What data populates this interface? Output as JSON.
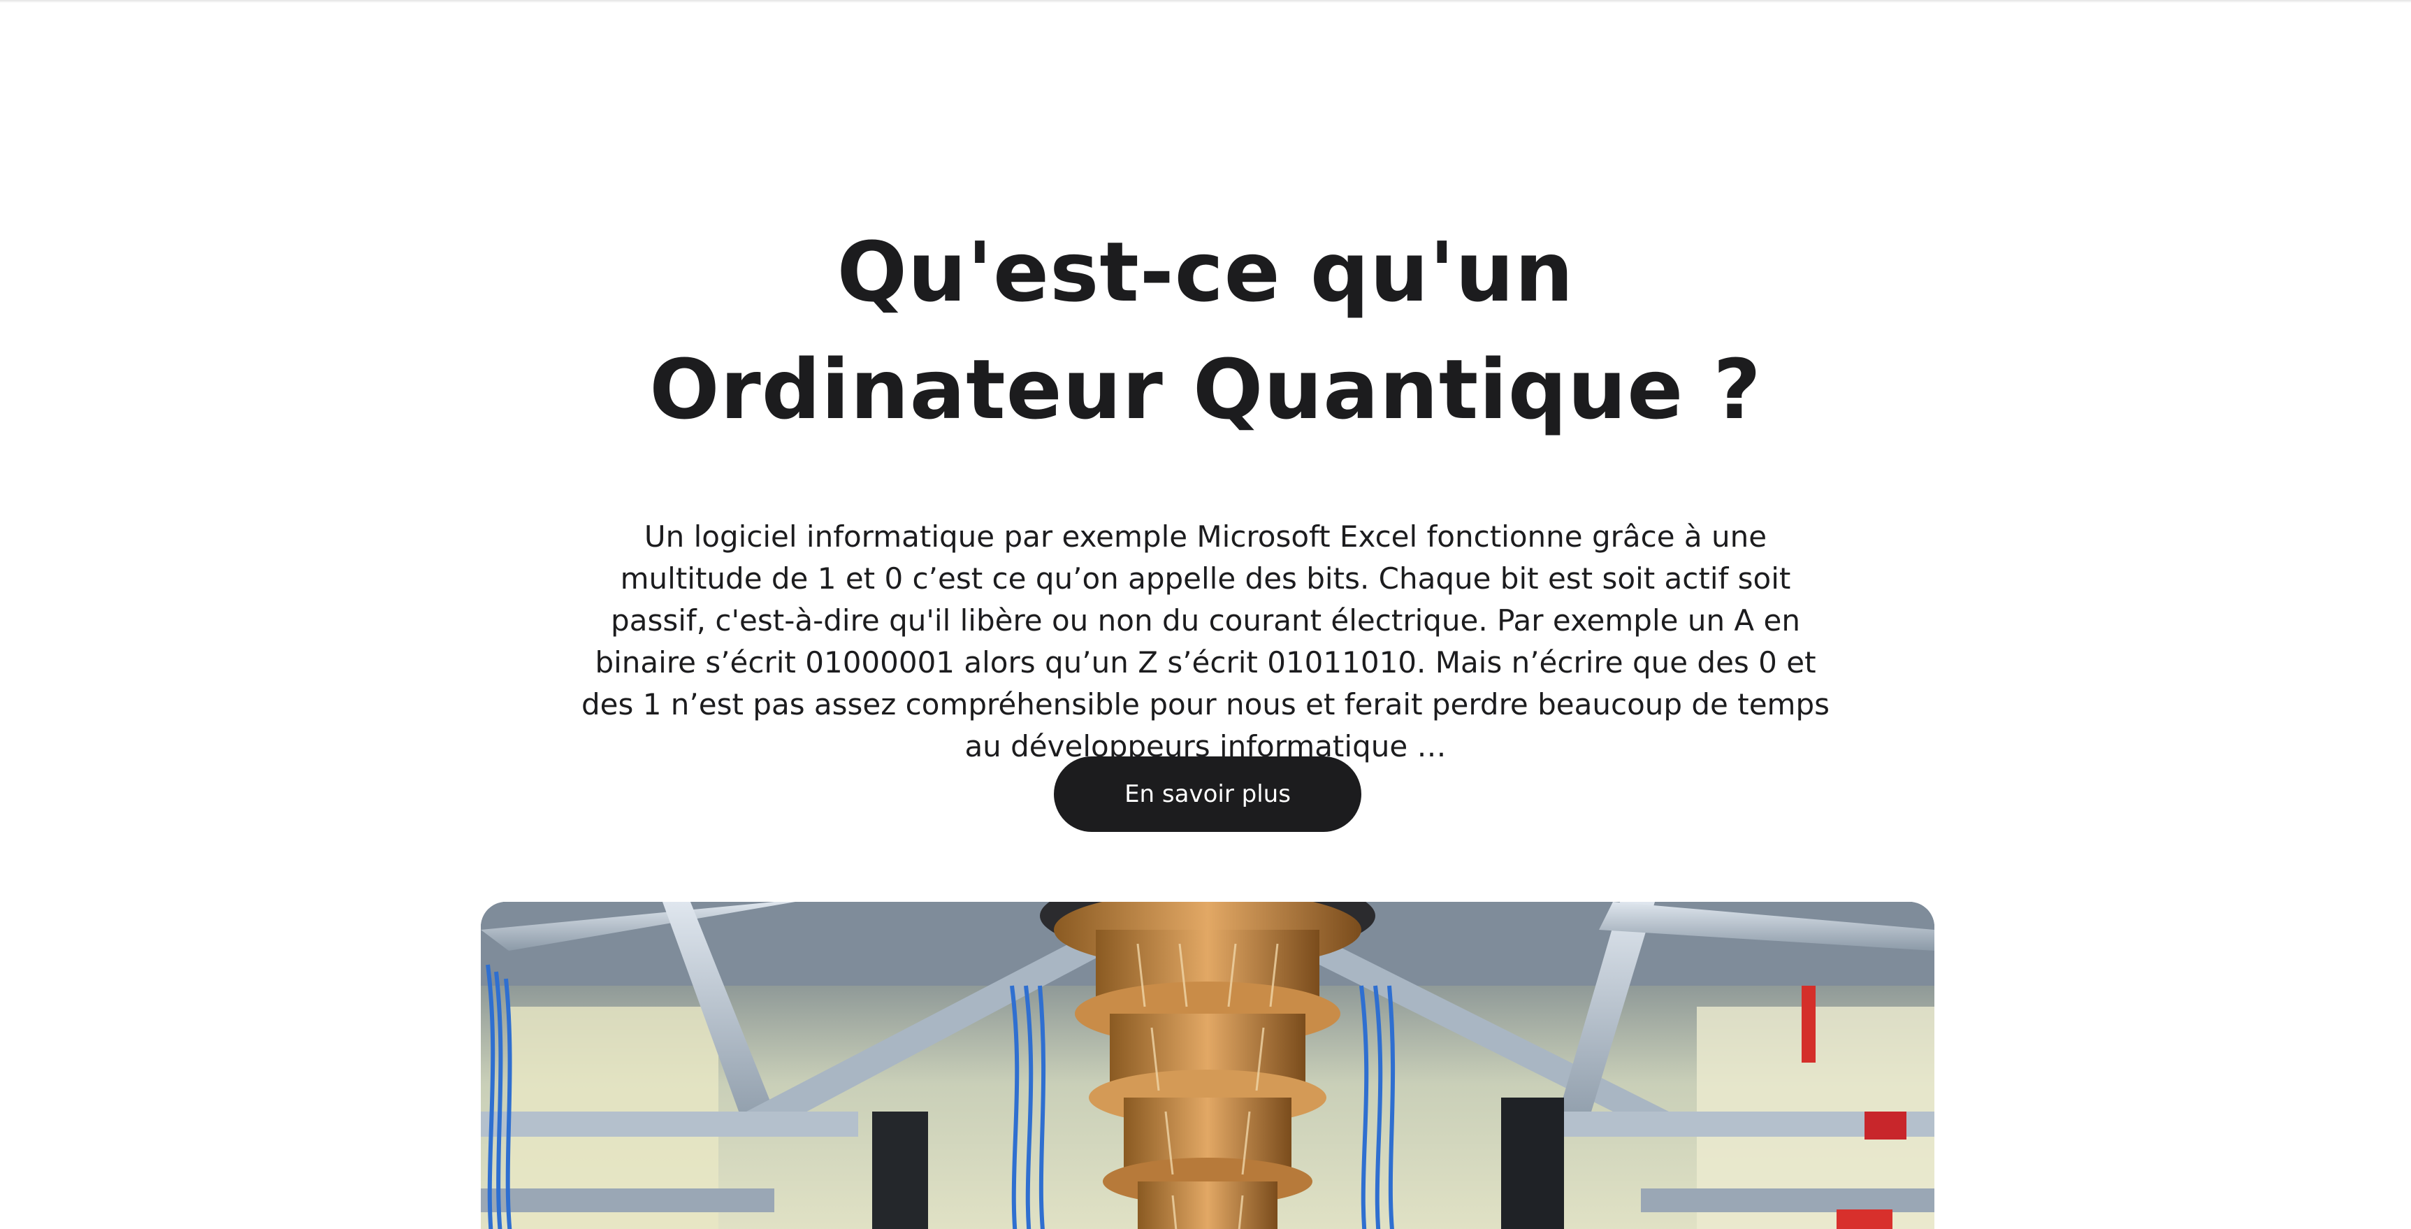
{
  "hero": {
    "title_line1": "Qu'est-ce qu'un",
    "title_line2": "Ordinateur Quantique ?",
    "description": "Un logiciel informatique par exemple Microsoft Excel fonctionne grâce à une multitude de 1 et 0 c’est ce qu’on appelle des bits. Chaque bit est soit actif soit passif, c'est-à-dire qu'il libère ou non du courant électrique. Par exemple un A en binaire s’écrit 01000001 alors qu’un Z s’écrit 01011010. Mais n’écrire que des 0 et des 1 n’est pas assez compréhensible pour nous et ferait perdre beaucoup de temps au développeurs informatique …",
    "cta_label": "En savoir plus"
  },
  "image": {
    "subject": "quantum-computer-cryostat-photo"
  },
  "colors": {
    "text": "#1c1c1e",
    "button_bg": "#1c1c1e",
    "button_text": "#ffffff",
    "background": "#ffffff"
  }
}
